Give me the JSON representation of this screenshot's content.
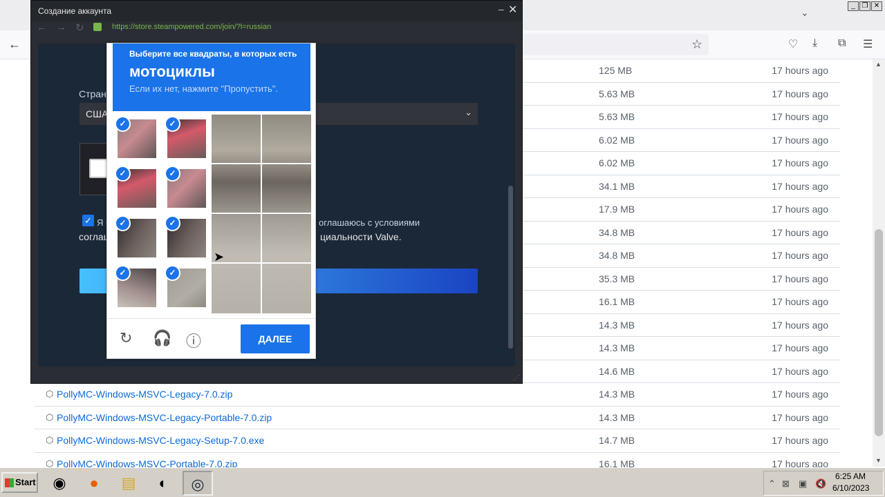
{
  "popup": {
    "title": "Создание аккаунта",
    "url": "https://store.steampowered.com/join/?l=russian",
    "country_label": "Страна",
    "country_value": "США",
    "agree_text_1": "Я по",
    "agree_text_2": "соглаше",
    "agree_text_3": "оглашаюсь с условиями",
    "agree_text_4": "циальности Valve."
  },
  "captcha": {
    "instruction": "Выберите все квадраты, в которых есть",
    "target": "мотоциклы",
    "hint": "Если их нет, нажмите \"Пропустить\".",
    "next_label": "ДАЛЕЕ"
  },
  "files": [
    {
      "name": "",
      "size": "125 MB",
      "time": "17 hours ago"
    },
    {
      "name": "",
      "size": "5.63 MB",
      "time": "17 hours ago"
    },
    {
      "name": "",
      "size": "5.63 MB",
      "time": "17 hours ago"
    },
    {
      "name": "",
      "size": "6.02 MB",
      "time": "17 hours ago"
    },
    {
      "name": "",
      "size": "6.02 MB",
      "time": "17 hours ago"
    },
    {
      "name": "",
      "size": "34.1 MB",
      "time": "17 hours ago"
    },
    {
      "name": "",
      "size": "17.9 MB",
      "time": "17 hours ago"
    },
    {
      "name": "",
      "size": "34.8 MB",
      "time": "17 hours ago"
    },
    {
      "name": "",
      "size": "34.8 MB",
      "time": "17 hours ago"
    },
    {
      "name": "",
      "size": "35.3 MB",
      "time": "17 hours ago"
    },
    {
      "name": "",
      "size": "16.1 MB",
      "time": "17 hours ago"
    },
    {
      "name": "",
      "size": "14.3 MB",
      "time": "17 hours ago"
    },
    {
      "name": "",
      "size": "14.3 MB",
      "time": "17 hours ago"
    },
    {
      "name": "",
      "size": "14.6 MB",
      "time": "17 hours ago"
    },
    {
      "name": "PollyMC-Windows-MSVC-Legacy-7.0.zip",
      "size": "14.3 MB",
      "time": "17 hours ago"
    },
    {
      "name": "PollyMC-Windows-MSVC-Legacy-Portable-7.0.zip",
      "size": "14.3 MB",
      "time": "17 hours ago"
    },
    {
      "name": "PollyMC-Windows-MSVC-Legacy-Setup-7.0.exe",
      "size": "14.7 MB",
      "time": "17 hours ago"
    },
    {
      "name": "PollyMC-Windows-MSVC-Portable-7.0.zip",
      "size": "16.1 MB",
      "time": "17 hours ago"
    }
  ],
  "taskbar": {
    "start_label": "Start",
    "apps": [
      "chrome-icon",
      "firefox-icon",
      "folder-icon",
      "mirror-icon",
      "steam-icon"
    ],
    "time": "6:25 AM",
    "date": "6/10/2023"
  },
  "colors": {
    "accent": "#1a73e8",
    "steam_bg": "#1b2838",
    "link": "#0969da"
  }
}
